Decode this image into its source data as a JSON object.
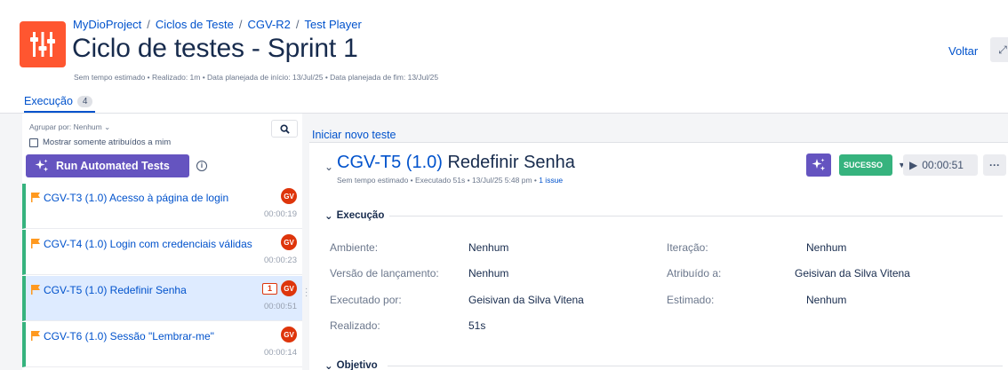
{
  "header": {
    "breadcrumb": [
      "MyDioProject",
      "Ciclos de Teste",
      "CGV-R2",
      "Test Player"
    ],
    "title": "Ciclo de testes - Sprint 1",
    "meta": "Sem tempo estimado • Realizado: 1m • Data planejada de início: 13/Jul/25 • Data planejada de fim: 13/Jul/25",
    "back_label": "Voltar",
    "expand_icon": "expand-icon"
  },
  "tabs": {
    "execution_label": "Execução",
    "execution_count": "4"
  },
  "sidebar": {
    "group_by": "Agrupar por: Nenhum ⌄",
    "only_assigned_label": "Mostrar somente atribuídos a mim",
    "run_button_label": "Run Automated Tests",
    "items": [
      {
        "title": "CGV-T3 (1.0) Acesso à página de login",
        "time": "00:00:19",
        "avatar": "GV",
        "issues": ""
      },
      {
        "title": "CGV-T4 (1.0) Login com credenciais válidas",
        "time": "00:00:23",
        "avatar": "GV",
        "issues": ""
      },
      {
        "title": "CGV-T5 (1.0) Redefinir Senha",
        "time": "00:00:51",
        "avatar": "GV",
        "issues": "1"
      },
      {
        "title": "CGV-T6 (1.0) Sessão \"Lembrar-me\"",
        "time": "00:00:14",
        "avatar": "GV",
        "issues": ""
      }
    ]
  },
  "detail": {
    "new_test_label": "Iniciar novo teste",
    "key": "CGV-T5 (1.0)",
    "name": "Redefinir Senha",
    "meta": "Sem tempo estimado • Executado 51s • 13/Jul/25 5:48 pm • ",
    "issue_link": "1 issue",
    "status_label": "SUCESSO",
    "timer": "00:00:51",
    "more_label": "···",
    "section_execution": "Execução",
    "section_objective": "Objetivo",
    "fields": {
      "env_label": "Ambiente:",
      "env_value": "Nenhum",
      "iteration_label": "Iteração:",
      "iteration_value": "Nenhum",
      "version_label": "Versão de lançamento:",
      "version_value": "Nenhum",
      "assigned_label": "Atribuído a:",
      "assigned_value": "Geisivan da Silva Vitena",
      "executed_by_label": "Executado por:",
      "executed_by_value": "Geisivan da Silva Vitena",
      "estimated_label": "Estimado:",
      "estimated_value": "Nenhum",
      "done_label": "Realizado:",
      "done_value": "51s"
    }
  },
  "colors": {
    "primary": "#0052cc",
    "success": "#36b37e",
    "purple": "#6554c0",
    "logo": "#ff5630",
    "avatar": "#de350b"
  }
}
